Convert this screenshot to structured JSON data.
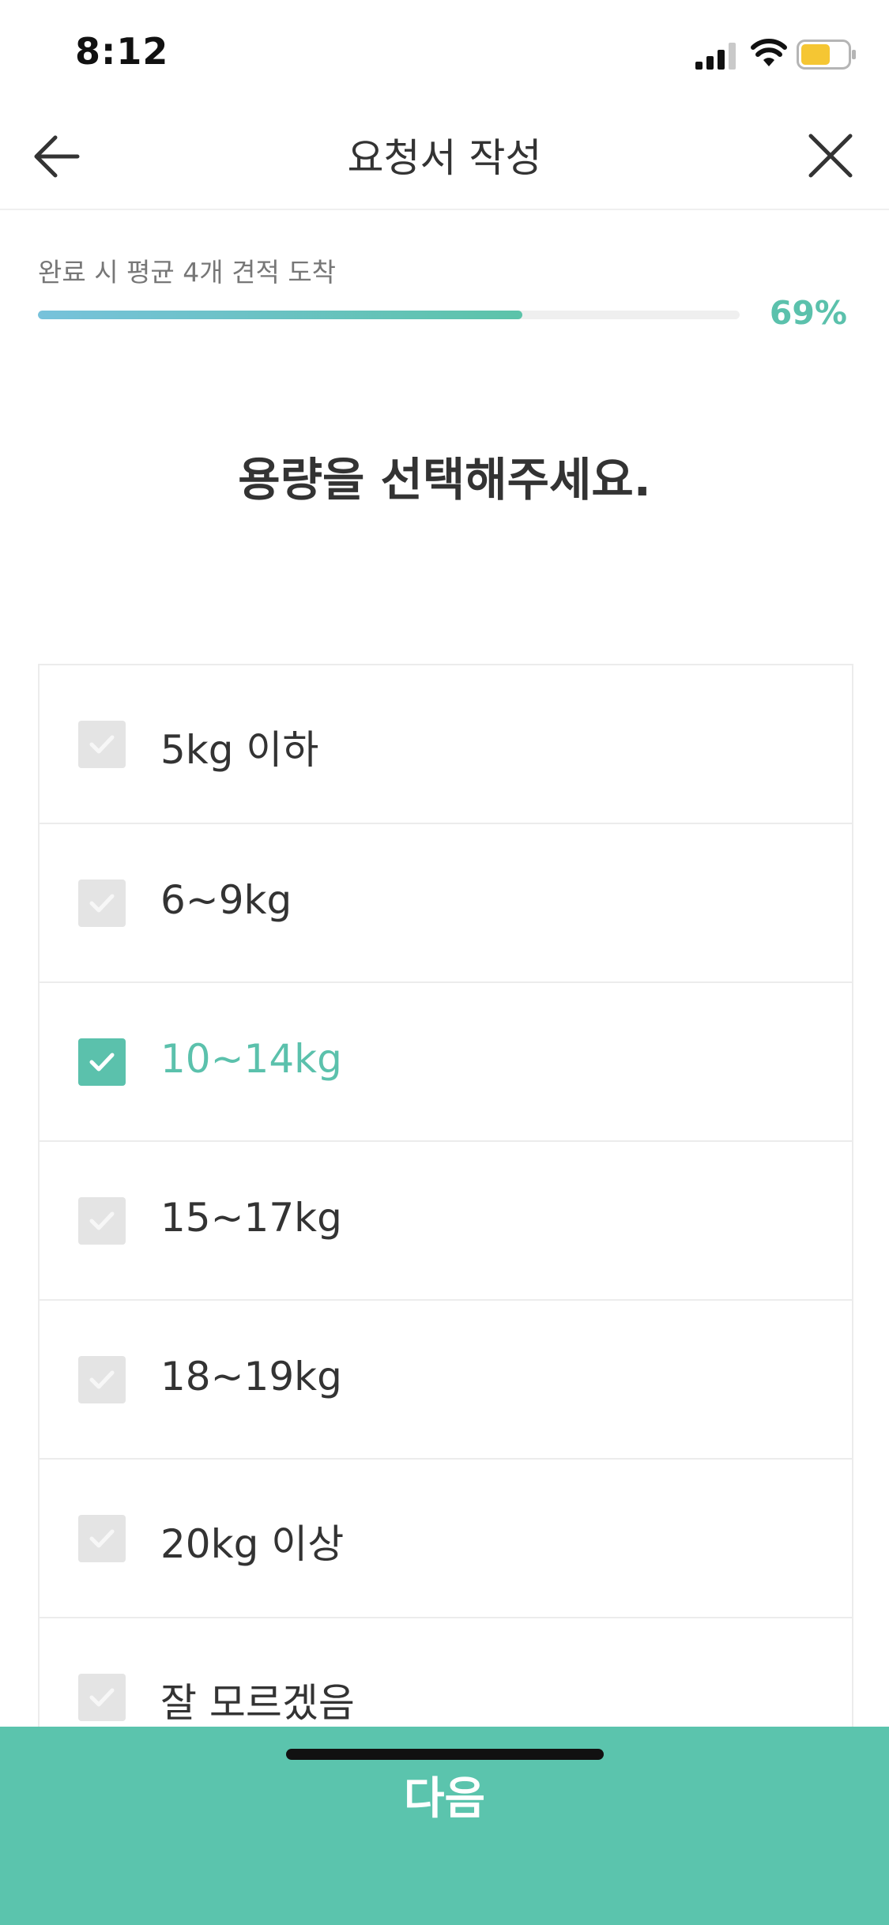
{
  "status_bar": {
    "time": "8:12",
    "icons": [
      "signal-icon",
      "wifi-icon",
      "battery-icon"
    ]
  },
  "nav": {
    "title": "요청서 작성",
    "back_icon": "arrow-left-icon",
    "close_icon": "close-icon"
  },
  "progress": {
    "caption": "완료 시 평균 4개 견적 도착",
    "percent_label": "69%",
    "value": 0.69
  },
  "question": {
    "title": "용량을 선택해주세요."
  },
  "options": [
    {
      "label": "5kg 이하",
      "checked": false
    },
    {
      "label": "6~9kg",
      "checked": false
    },
    {
      "label": "10~14kg",
      "checked": true
    },
    {
      "label": "15~17kg",
      "checked": false
    },
    {
      "label": "18~19kg",
      "checked": false
    },
    {
      "label": "20kg 이상",
      "checked": false
    },
    {
      "label": "잘 모르겠음",
      "checked": false
    }
  ],
  "next_button": {
    "label": "다음"
  },
  "colors": {
    "accent": "#5bc1ac",
    "button_bg": "#5bc4ad",
    "checkbox_off": "#e4e4e4",
    "progress_start": "#77c2db",
    "progress_end": "#5cc3a9",
    "text": "#333333"
  }
}
